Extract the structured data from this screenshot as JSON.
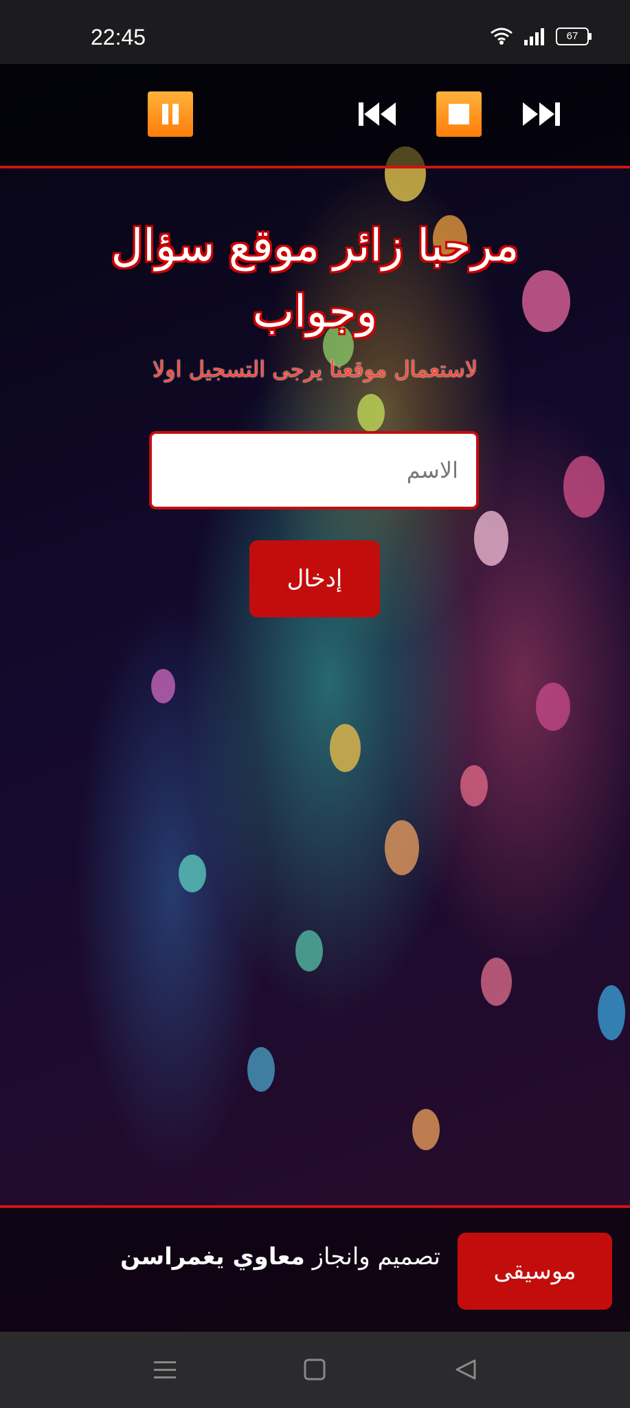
{
  "status_bar": {
    "time": "22:45",
    "battery": "67"
  },
  "player": {
    "pause_icon": "pause-icon",
    "previous_icon": "skip-previous-icon",
    "stop_icon": "stop-icon",
    "next_icon": "skip-next-icon"
  },
  "welcome": {
    "title": "مرحبا زائر موقع سؤال وجواب",
    "subtitle": "لاستعمال موقعنا يرجى التسجيل اولا",
    "name_placeholder": "الاسم",
    "submit_label": "إدخال"
  },
  "footer": {
    "credit_prefix": "تصميم وانجاز",
    "credit_name": "معاوي يغمراسن",
    "music_label": "موسيقى"
  },
  "colors": {
    "accent_red": "#c30d0d",
    "player_orange": "#ff8a14"
  }
}
